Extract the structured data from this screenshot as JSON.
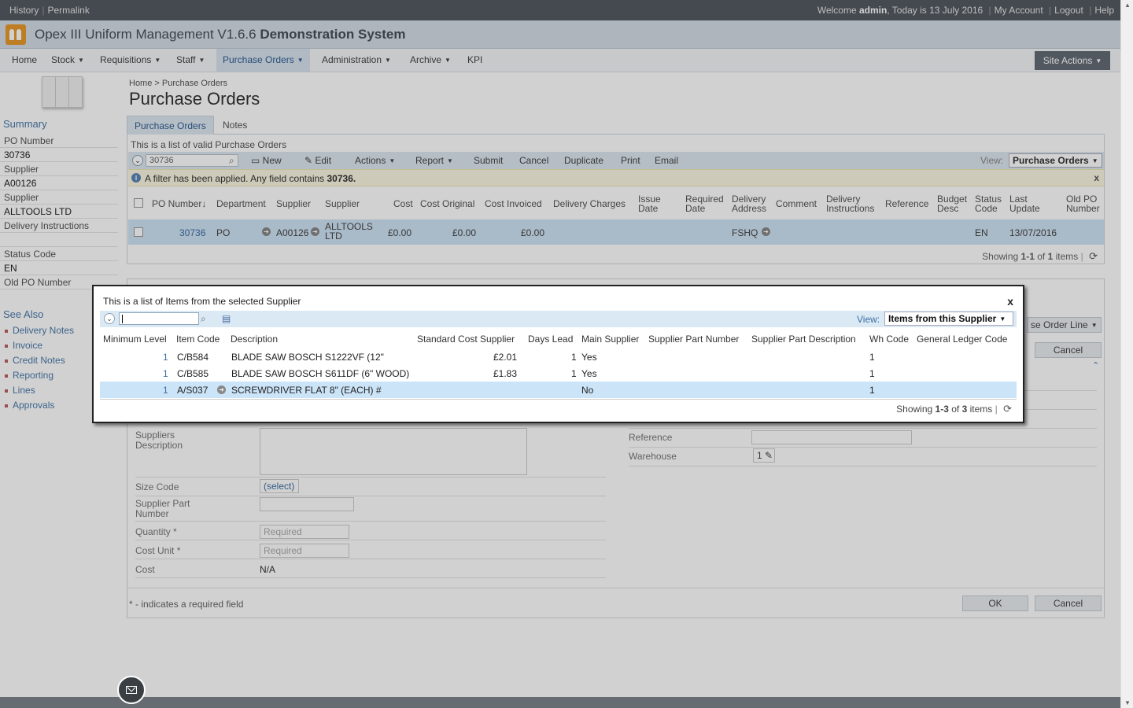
{
  "topbar": {
    "history": "History",
    "permalink": "Permalink",
    "welcome_prefix": "Welcome",
    "user": "admin",
    "date_text": ", Today is 13 July 2016",
    "my_account": "My Account",
    "logout": "Logout",
    "help": "Help"
  },
  "header": {
    "title_plain": "Opex III Uniform Management V1.6.6",
    "title_bold": "Demonstration System"
  },
  "nav": {
    "items": [
      "Home",
      "Stock",
      "Requisitions",
      "Staff",
      "Purchase Orders",
      "Administration",
      "Archive",
      "KPI"
    ],
    "site_actions": "Site Actions"
  },
  "sidebar": {
    "summary_heading": "Summary",
    "fields": [
      {
        "label": "PO Number",
        "value": "30736"
      },
      {
        "label": "Supplier",
        "value": "A00126"
      },
      {
        "label": "Supplier",
        "value": "ALLTOOLS LTD"
      },
      {
        "label": "Delivery Instructions",
        "value": ""
      },
      {
        "label": "Status Code",
        "value": "EN"
      },
      {
        "label": "Old PO Number",
        "value": ""
      }
    ],
    "see_also_heading": "See Also",
    "links": [
      "Delivery Notes",
      "Invoice",
      "Credit Notes",
      "Reporting",
      "Lines",
      "Approvals"
    ]
  },
  "breadcrumb": {
    "home": "Home",
    "sep": ">",
    "current": "Purchase Orders"
  },
  "page_title": "Purchase Orders",
  "tabs": [
    "Purchase Orders",
    "Notes"
  ],
  "list": {
    "description": "This is a list of valid Purchase Orders",
    "search_value": "30736",
    "toolbar": [
      "New",
      "Edit",
      "Actions",
      "Report",
      "Submit",
      "Cancel",
      "Duplicate",
      "Print",
      "Email"
    ],
    "view_label": "View:",
    "view_value": "Purchase Orders",
    "filter_text": "A filter has been applied. Any field contains",
    "filter_value": "30736.",
    "columns": [
      "PO Number↓",
      "Department",
      "Supplier",
      "Supplier",
      "Cost",
      "Cost Original",
      "Cost Invoiced",
      "Delivery Charges",
      "Issue Date",
      "Required Date",
      "Delivery Address",
      "Comment",
      "Delivery Instructions",
      "Reference",
      "Budget Desc",
      "Status Code",
      "Last Update",
      "Old PO Number"
    ],
    "row": {
      "po_number": "30736",
      "department": "PO",
      "supplier_code": "A00126",
      "supplier_name": "ALLTOOLS LTD",
      "cost": "£0.00",
      "cost_original": "£0.00",
      "cost_invoiced": "£0.00",
      "delivery_address": "FSHQ",
      "status": "EN",
      "last_update": "13/07/2016"
    },
    "showing": "Showing",
    "range": "1-1",
    "of": "of",
    "total": "1",
    "items_word": "items"
  },
  "lower_form": {
    "fields_left": [
      "Suppliers Description",
      "Size Code",
      "Supplier Part Number",
      "Quantity",
      "Cost Unit",
      "Cost"
    ],
    "size_code_select": "(select)",
    "required_placeholder": "Required",
    "cost_value": "N/A",
    "fields_right": [
      "Reference",
      "Warehouse"
    ],
    "warehouse_value": "1",
    "order_line_select": "se Order Line",
    "cancel_top": "Cancel",
    "required_note": "* - indicates a required field",
    "ok": "OK",
    "cancel": "Cancel"
  },
  "dialog": {
    "title": "This is a list of Items from the selected Supplier",
    "close": "x",
    "view_label": "View:",
    "view_value": "Items from this Supplier",
    "columns": [
      "Minimum Level",
      "Item Code",
      "Description",
      "Standard Cost Supplier",
      "Days Lead",
      "Main Supplier",
      "Supplier Part Number",
      "Supplier Part Description",
      "Wh Code",
      "General Ledger Code"
    ],
    "rows": [
      {
        "min_level": "1",
        "item_code": "C/B584",
        "description": "BLADE SAW BOSCH S1222VF (12\"",
        "std_cost": "£2.01",
        "days_lead": "1",
        "main_supplier": "Yes",
        "wh_code": "1"
      },
      {
        "min_level": "1",
        "item_code": "C/B585",
        "description": "BLADE SAW BOSCH S611DF (6\" WOOD)",
        "std_cost": "£1.83",
        "days_lead": "1",
        "main_supplier": "Yes",
        "wh_code": "1"
      },
      {
        "min_level": "1",
        "item_code": "A/S037",
        "description": "SCREWDRIVER FLAT 8\" (EACH) #",
        "std_cost": "",
        "days_lead": "",
        "main_supplier": "No",
        "wh_code": "1"
      }
    ],
    "showing": "Showing",
    "range": "1-3",
    "of": "of",
    "total": "3",
    "items_word": "items"
  }
}
